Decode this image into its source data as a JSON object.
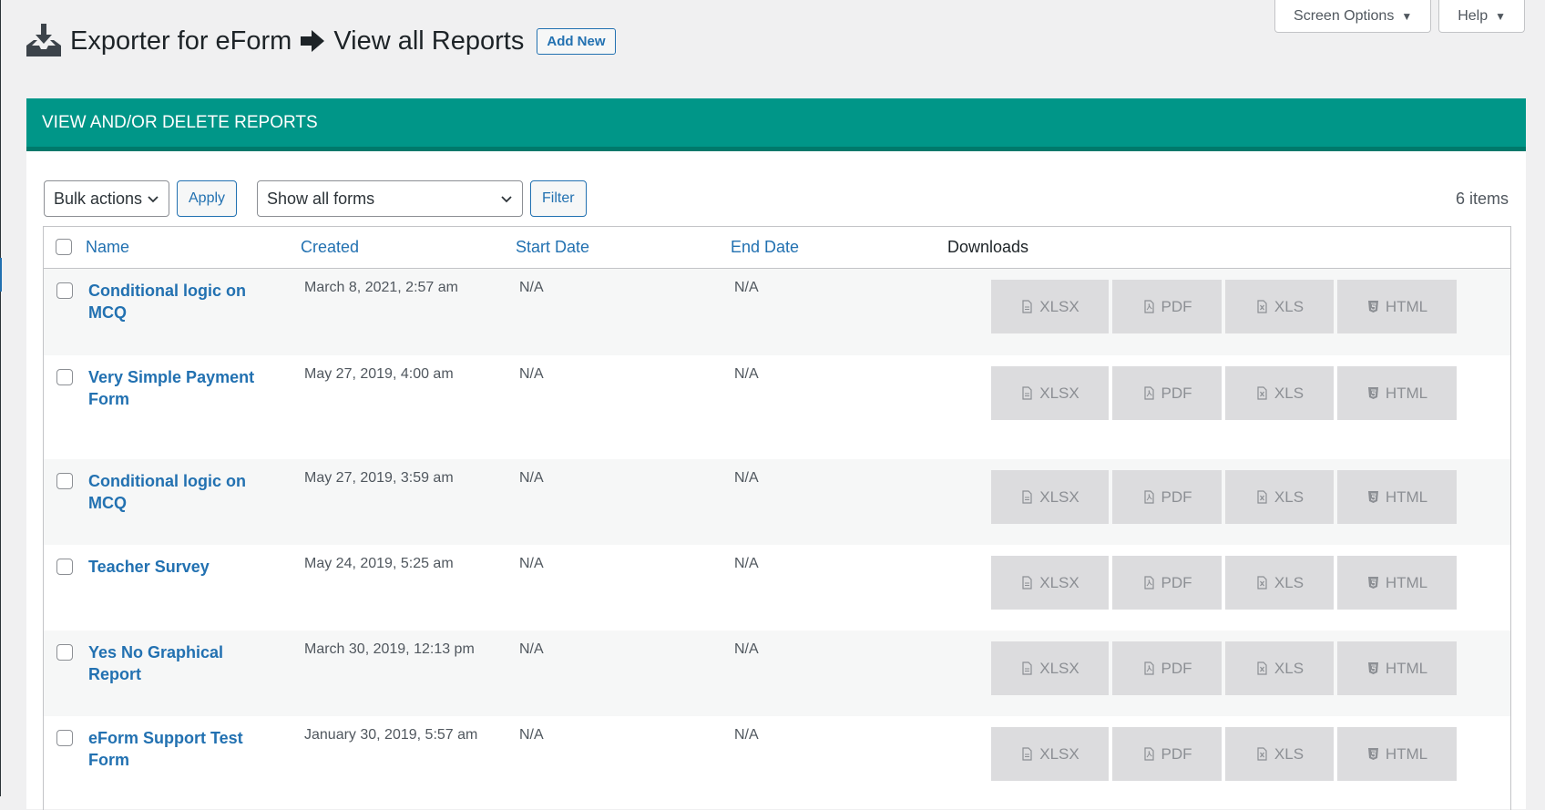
{
  "header": {
    "title_plugin": "Exporter for eForm",
    "title_page": "View all Reports",
    "add_new_label": "Add New",
    "download_icon": "download-tray-icon",
    "arrow_icon": "arrow-right-icon"
  },
  "screen_meta": {
    "screen_options_label": "Screen Options",
    "help_label": "Help",
    "caret": "▼"
  },
  "panel": {
    "title": "VIEW AND/OR DELETE REPORTS",
    "accent_color": "#009688"
  },
  "tablenav": {
    "bulk_actions": "Bulk actions",
    "apply_label": "Apply",
    "forms_filter": "Show all forms",
    "filter_label": "Filter",
    "items_count": "6 items"
  },
  "table": {
    "columns": [
      "Name",
      "Created",
      "Start Date",
      "End Date",
      "Downloads"
    ],
    "download_labels": {
      "xlsx": "XLSX",
      "pdf": "PDF",
      "xls": "XLS",
      "html": "HTML"
    },
    "rows": [
      {
        "name": "Conditional logic on MCQ",
        "created": "March 8, 2021, 2:57 am",
        "start": "N/A",
        "end": "N/A"
      },
      {
        "name": "Very Simple Payment Form",
        "created": "May 27, 2019, 4:00 am",
        "start": "N/A",
        "end": "N/A"
      },
      {
        "name": "Conditional logic on MCQ",
        "created": "May 27, 2019, 3:59 am",
        "start": "N/A",
        "end": "N/A"
      },
      {
        "name": "Teacher Survey",
        "created": "May 24, 2019, 5:25 am",
        "start": "N/A",
        "end": "N/A"
      },
      {
        "name": "Yes No Graphical Report",
        "created": "March 30, 2019, 12:13 pm",
        "start": "N/A",
        "end": "N/A"
      },
      {
        "name": "eForm Support Test Form",
        "created": "January 30, 2019, 5:57 am",
        "start": "N/A",
        "end": "N/A"
      }
    ]
  }
}
